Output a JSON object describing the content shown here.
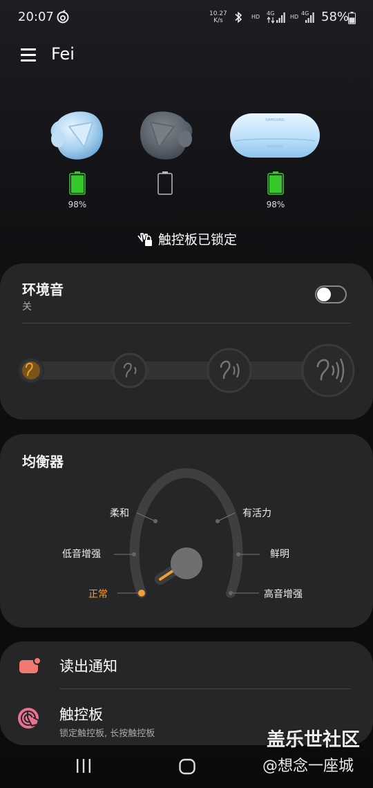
{
  "status_bar": {
    "time": "20:07",
    "net_speed_value": "10.27",
    "net_speed_unit": "K/s",
    "hd1": "HD",
    "net1": "4G",
    "hd2": "HD",
    "net2": "4G",
    "battery": "58%"
  },
  "header": {
    "device_name": "Fei"
  },
  "devices": {
    "left_bud": {
      "battery": "98%",
      "battery_level": 0.98
    },
    "right_bud": {
      "battery": "",
      "battery_level": 0.0
    },
    "case": {
      "battery": "98%",
      "battery_level": 0.98,
      "brand_text": "SAMSUNG"
    }
  },
  "touch_lock": {
    "label": "触控板已锁定"
  },
  "ambient": {
    "title": "环境音",
    "status": "关",
    "enabled": false,
    "level": 0,
    "level_count": 4
  },
  "equalizer": {
    "title": "均衡器",
    "presets": [
      "正常",
      "低音增强",
      "柔和",
      "有活力",
      "鲜明",
      "高音增强"
    ],
    "selected": "正常"
  },
  "settings_list": {
    "read_notifications": {
      "title": "读出通知"
    },
    "touchpad": {
      "title": "触控板",
      "subtitle": "锁定触控板, 长按触控板"
    }
  },
  "watermark": {
    "line1": "盖乐世社区",
    "line2": "@想念一座城"
  },
  "colors": {
    "accent": "#f0a030",
    "battery_green": "#36c82a",
    "card": "#262628",
    "notif_icon": "#f07a72",
    "touch_icon": "#e8728f"
  }
}
